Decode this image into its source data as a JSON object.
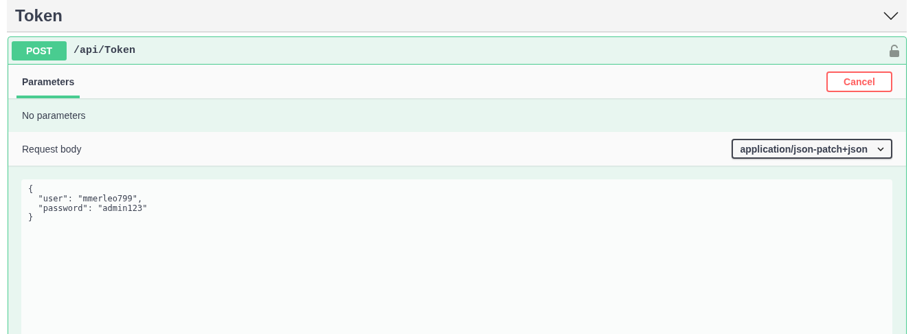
{
  "section": {
    "title": "Token",
    "expanded": true
  },
  "operation": {
    "method": "POST",
    "path": "/api/Token",
    "locked": false
  },
  "tabs": [
    {
      "label": "Parameters",
      "selected": true
    }
  ],
  "cancel_button": "Cancel",
  "parameters_message": "No parameters",
  "request_body": {
    "label": "Request body",
    "content_type": "application/json-patch+json",
    "value": "{\n  \"user\": \"mmerleo799\",\n  \"password\": \"admin123\"\n}"
  }
}
